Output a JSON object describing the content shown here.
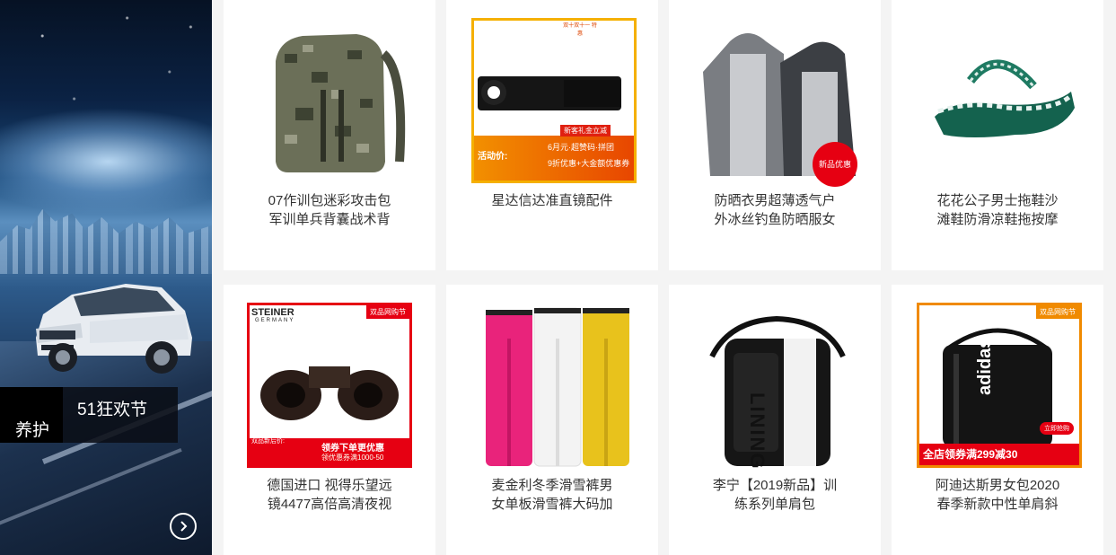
{
  "banner": {
    "title": "51狂欢节",
    "subtitle": "养护",
    "next_icon": "chevron-right-icon"
  },
  "products": [
    {
      "title": "07作训包迷彩攻击包\n军训单兵背囊战术背",
      "icon": "camo-backpack-image"
    },
    {
      "title": "星达信达准直镜配件",
      "icon": "collimator-tube-image",
      "badges": {
        "top": "双十双十一 特惠",
        "gift": "新客礼金立减",
        "activity": "活动价:",
        "line1": "6月元·超赞码·拼团",
        "line2": "9折优惠+大金额优惠券"
      }
    },
    {
      "title": "防晒衣男超薄透气户\n外冰丝钓鱼防晒服女",
      "icon": "jacket-image",
      "badge": "新品优惠"
    },
    {
      "title": "花花公子男士拖鞋沙\n滩鞋防滑凉鞋拖按摩",
      "icon": "flip-flop-image"
    },
    {
      "title": "德国进口 视得乐望远\n镜4477高倍高清夜视",
      "icon": "binoculars-image",
      "badges": {
        "brand": "STEINER",
        "brand_sub": "GERMANY",
        "corner": "双品网购节",
        "price_tag": "双品新后价:",
        "coupon": "领券下单更优惠",
        "coupon_sub": "领优惠券满1000-50"
      }
    },
    {
      "title": "麦金利冬季滑雪裤男\n女单板滑雪裤大码加",
      "icon": "ski-pants-image"
    },
    {
      "title": "李宁【2019新品】训\n练系列单肩包",
      "icon": "shoulder-bag-image",
      "brand_print": "LINING"
    },
    {
      "title": "阿迪达斯男女包2020\n春季新款中性单肩斜",
      "icon": "adidas-bag-image",
      "badges": {
        "corner": "双品网购节",
        "brand_print": "adidas",
        "coupon": "全店领券满299减30",
        "btn": "立即抢购"
      }
    }
  ],
  "colors": {
    "accent_red": "#e60012",
    "promo_bg": "#0a0e16",
    "card_bg": "#ffffff"
  }
}
